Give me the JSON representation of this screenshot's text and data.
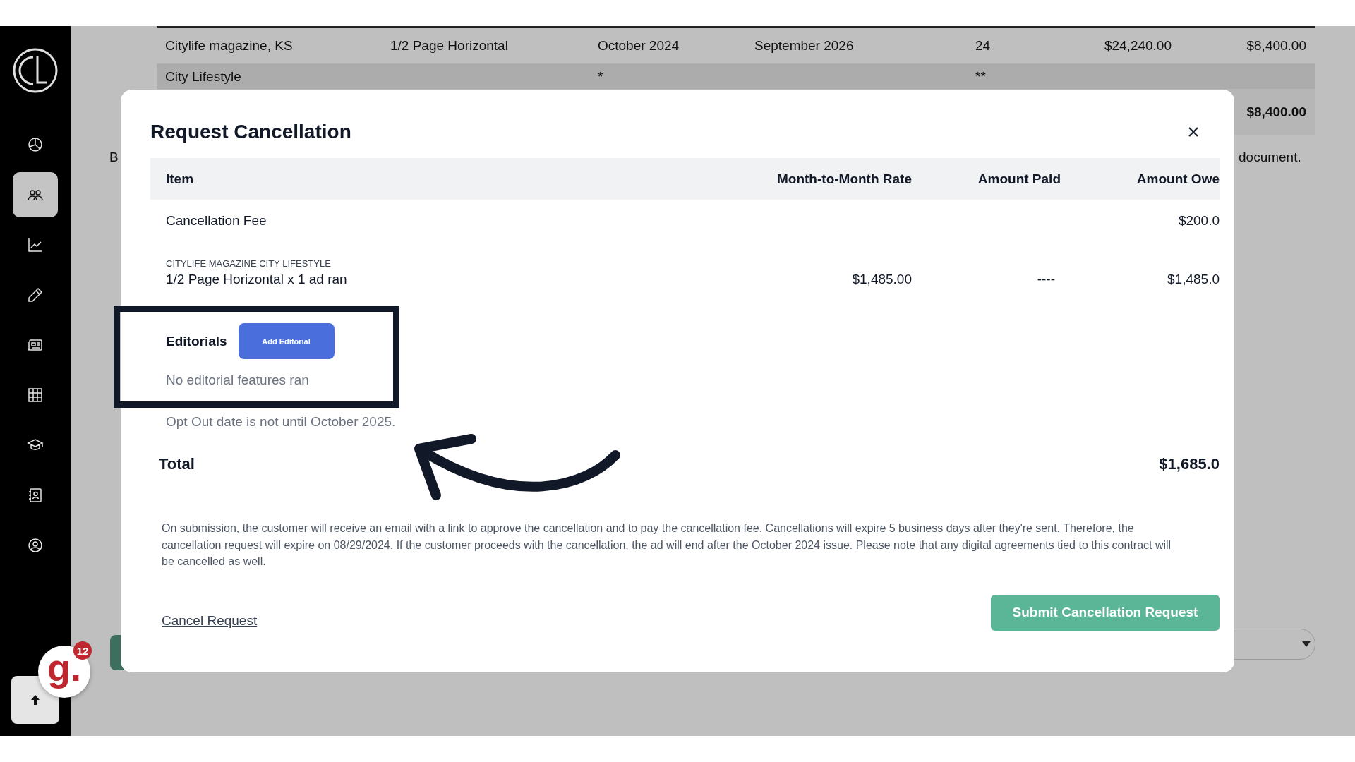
{
  "sidebar": {
    "items": [
      {
        "selected": false
      },
      {
        "selected": true
      },
      {
        "selected": false
      },
      {
        "selected": false
      },
      {
        "selected": false
      },
      {
        "selected": false
      },
      {
        "selected": false
      },
      {
        "selected": false
      },
      {
        "selected": false
      }
    ]
  },
  "background_table": {
    "rows": [
      {
        "column_1": "Citylife magazine, KS",
        "column_2": "1/2 Page Horizontal",
        "column_3": "October 2024",
        "column_4": "September 2026",
        "column_5": "24",
        "column_6": "$24,240.00",
        "column_7": "$8,400.00"
      },
      {
        "column_1": "City Lifestyle",
        "column_3": "*",
        "column_5": "**"
      },
      {
        "column_7": "$8,400.00",
        "kind": "total"
      }
    ]
  },
  "background_text": [
    "B",
    "document."
  ],
  "modal": {
    "title": "Request Cancellation",
    "columns": [
      "Item",
      "Month-to-Month Rate",
      "Amount Paid",
      "Amount Owe"
    ],
    "rows": [
      {
        "item": "Cancellation Fee",
        "owed": "$200.0"
      },
      {
        "caption": "CITYLIFE MAGAZINE CITY LIFESTYLE",
        "item": "1/2 Page Horizontal x 1 ad ran",
        "rate": "$1,485.00",
        "paid": "----",
        "owed": "$1,485.0"
      }
    ],
    "editorials": {
      "label": "Editorials",
      "button": "Add Editorial",
      "empty": "No editorial features ran"
    },
    "opt_out_note": "Opt Out date is not until October 2025.",
    "total": {
      "label": "Total",
      "amount": "$1,685.0"
    },
    "notice": "On submission, the customer will receive an email with a link to approve the cancellation and to pay the cancellation fee. Cancellations will expire 5 business days after they're sent. Therefore, the cancellation request will expire on 08/29/2024. If the customer proceeds with the cancellation, the ad will end after the October 2024 issue. Please note that any digital agreements tied to this contract will be cancelled as well.",
    "cancel_link": "Cancel Request",
    "submit_button": "Submit Cancellation Request"
  },
  "chat_widget": {
    "logo": "g.",
    "badge": "12"
  }
}
